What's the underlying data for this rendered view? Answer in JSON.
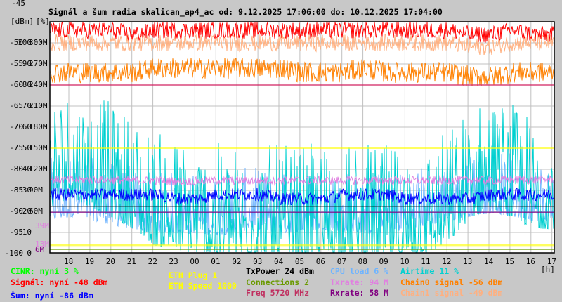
{
  "chart_data": {
    "type": "line",
    "title": "Signál a šum radia skalican_ap4_ac od: 9.12.2025 17:06:00 do: 10.12.2025 17:04:00",
    "unit_labels": [
      "[dBm]",
      "[%]"
    ],
    "xlabel": "[h]",
    "x_ticks": [
      "18",
      "19",
      "20",
      "21",
      "22",
      "23",
      "00",
      "01",
      "02",
      "03",
      "04",
      "05",
      "06",
      "07",
      "08",
      "09",
      "10",
      "11",
      "12",
      "13",
      "14",
      "15",
      "16",
      "17"
    ],
    "y_ticks_dbm": [
      "-45",
      "-50",
      "-55",
      "-60",
      "-65",
      "-70",
      "-75",
      "-80",
      "-85",
      "-90",
      "-95",
      "-100"
    ],
    "y_ticks_pct": [
      "100",
      "90",
      "80",
      "70",
      "60",
      "50",
      "40",
      "30",
      "20",
      "10",
      "0"
    ],
    "y_ticks_rate": [
      "300M",
      "270M",
      "240M",
      "210M",
      "180M",
      "150M",
      "120M",
      "90M",
      "60M"
    ],
    "rate_markers": [
      {
        "label": "39M",
        "color": "#e080e0"
      },
      {
        "label": "13M",
        "color": "#e080e0"
      },
      {
        "label": "6M",
        "color": "#800080"
      }
    ],
    "ylim_dbm": [
      -100,
      -45
    ],
    "ylim_pct": [
      0,
      100
    ],
    "ylim_rate": [
      0,
      300
    ],
    "grid": true,
    "hours": [
      17,
      18,
      19,
      20,
      21,
      22,
      23,
      0,
      1,
      2,
      3,
      4,
      5,
      6,
      7,
      8,
      9,
      10,
      11,
      12,
      13,
      14,
      15,
      16
    ],
    "series": [
      {
        "name": "Signál",
        "axis": "dbm",
        "color": "#ff0000",
        "noise": 4,
        "values": [
          -47,
          -47,
          -47,
          -47,
          -48,
          -47,
          -47,
          -47,
          -47,
          -47,
          -47,
          -47,
          -47,
          -47,
          -47,
          -47,
          -47,
          -47,
          -47,
          -47,
          -48,
          -48,
          -47,
          -48
        ]
      },
      {
        "name": "Chain1 signal",
        "axis": "dbm",
        "color": "#ffb080",
        "noise": 4,
        "values": [
          -50,
          -50,
          -50,
          -50,
          -50,
          -50,
          -50,
          -50,
          -50,
          -50,
          -50,
          -50,
          -50,
          -50,
          -50,
          -50,
          -50,
          -50,
          -50,
          -50,
          -51,
          -51,
          -50,
          -50
        ]
      },
      {
        "name": "Chain0 signal",
        "axis": "dbm",
        "color": "#ff8000",
        "noise": 5,
        "values": [
          -57,
          -57,
          -57,
          -57,
          -57,
          -56,
          -56,
          -56,
          -56,
          -56,
          -56,
          -56,
          -57,
          -57,
          -57,
          -56,
          -57,
          -57,
          -57,
          -57,
          -58,
          -58,
          -57,
          -57
        ]
      },
      {
        "name": "Šum",
        "axis": "dbm",
        "color": "#0000ff",
        "noise": 3,
        "values": [
          -86,
          -86,
          -86,
          -86,
          -86,
          -86,
          -87,
          -87,
          -86,
          -86,
          -86,
          -87,
          -87,
          -87,
          -86,
          -86,
          -86,
          -87,
          -87,
          -87,
          -87,
          -86,
          -86,
          -86
        ]
      },
      {
        "name": "Txrate",
        "axis": "rate",
        "color": "#e080e0",
        "noise": 12,
        "values": [
          105,
          105,
          105,
          105,
          104,
          104,
          103,
          103,
          104,
          104,
          104,
          104,
          104,
          104,
          104,
          104,
          104,
          104,
          104,
          104,
          105,
          104,
          105,
          105
        ]
      },
      {
        "name": "CPU load",
        "axis": "pct",
        "color": "#6eb4ff",
        "noise": 30,
        "values": [
          20,
          22,
          20,
          18,
          16,
          14,
          14,
          14,
          13,
          15,
          16,
          14,
          15,
          16,
          15,
          14,
          14,
          16,
          18,
          20,
          22,
          24,
          22,
          20
        ]
      },
      {
        "name": "Airtime",
        "axis": "pct",
        "color": "#00d0d0",
        "noise": 55,
        "values": [
          30,
          35,
          30,
          25,
          20,
          12,
          10,
          8,
          6,
          6,
          6,
          5,
          5,
          6,
          6,
          6,
          5,
          6,
          8,
          14,
          25,
          30,
          25,
          20
        ]
      }
    ],
    "reference_lines": [
      {
        "name": "Freq",
        "color": "#d02060",
        "dbm": -60
      },
      {
        "name": "ETH Speed",
        "color": "#ffff00",
        "dbm": -75
      },
      {
        "name": "TxPower",
        "color": "#000000",
        "dbm": -88.8
      },
      {
        "name": "Rxrate",
        "color": "#800080",
        "dbm": -90.2
      },
      {
        "name": "ETH Plug",
        "color": "#ffff00",
        "dbm": -98
      },
      {
        "name": "ETH Plug 2",
        "color": "#ffff00",
        "dbm": -98.4
      },
      {
        "name": "Connections",
        "color": "#6a9a00",
        "dbm": -99
      }
    ]
  },
  "legend": {
    "cinr": {
      "text": "CINR: nyní 3 %",
      "color": "#00ff00"
    },
    "signal": {
      "text": "Signál: nyní -48 dBm",
      "color": "#ff0000"
    },
    "noise": {
      "text": "Šum: nyní -86 dBm",
      "color": "#0000ff"
    },
    "eth_plug": {
      "text": "ETH Plug 1",
      "color": "#ffff00"
    },
    "eth_speed": {
      "text": "ETH Speed 1000",
      "color": "#ffff00"
    },
    "txpower": {
      "text": "TxPower 24 dBm",
      "color": "#000000"
    },
    "connections": {
      "text": "Connections 2",
      "color": "#6a9a00"
    },
    "freq": {
      "text": "Freq 5720 MHz",
      "color": "#c03060"
    },
    "cpu": {
      "text": "CPU load 6 %",
      "color": "#6eb4ff"
    },
    "txrate": {
      "text": "Txrate: 94 M",
      "color": "#e080e0"
    },
    "rxrate": {
      "text": "Rxrate: 58 M",
      "color": "#800080"
    },
    "airtime": {
      "text": "Airtime 11 %",
      "color": "#00d0d0"
    },
    "chain0": {
      "text": "Chain0 signal -56 dBm",
      "color": "#ff8000"
    },
    "chain1": {
      "text": "Chain1 signal -49 dBm",
      "color": "#ffb080"
    }
  }
}
